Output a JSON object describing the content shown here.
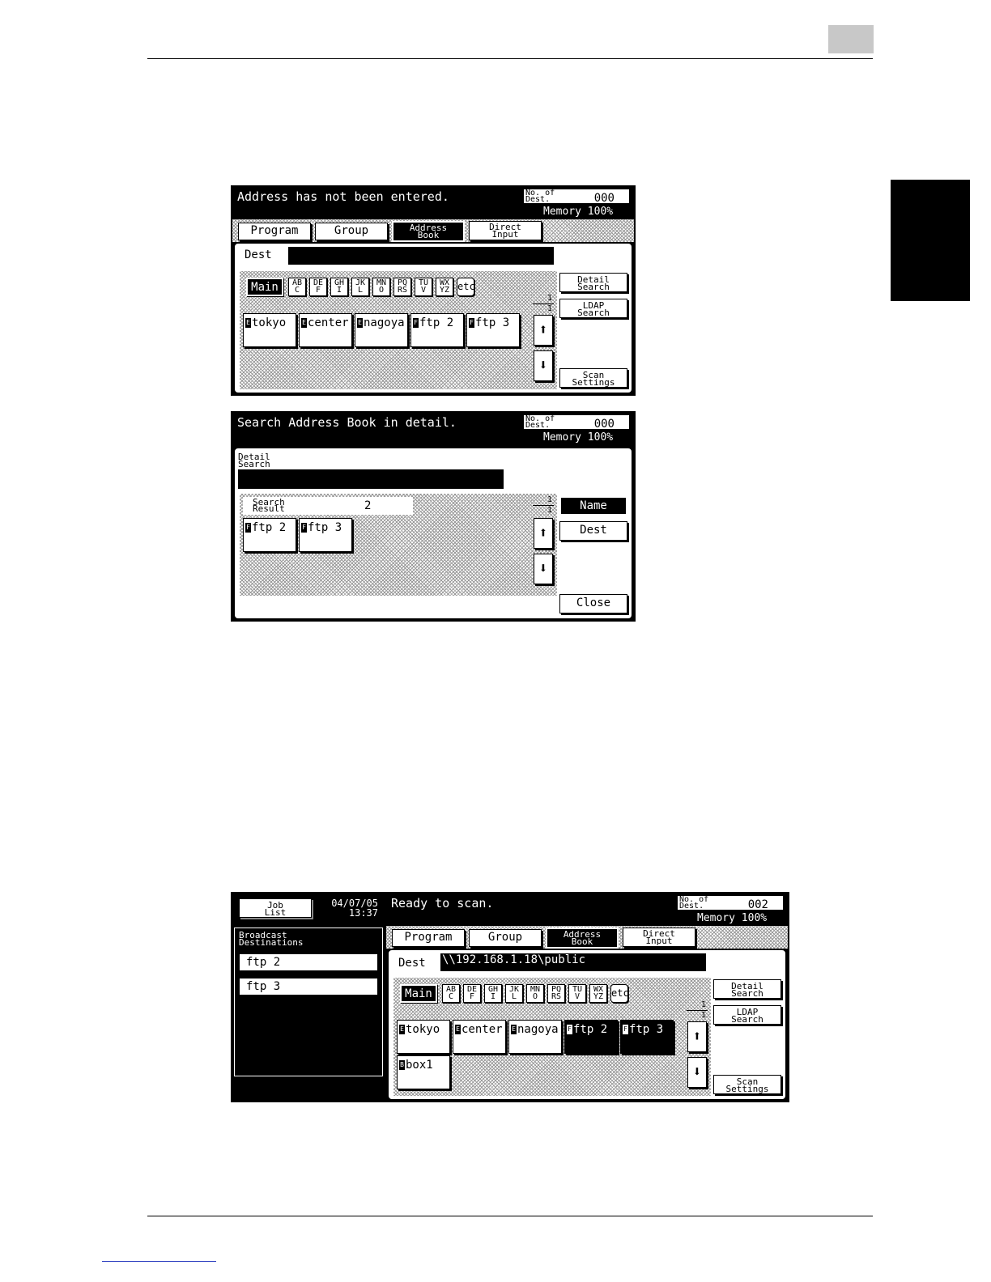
{
  "page": {
    "chapter_tab_color": "#000000",
    "link_color": "#2a3cbf"
  },
  "screen1": {
    "message": "Address has not been entered.",
    "counter_label": "No. of\nDest.",
    "counter_value": "000",
    "memory": "Memory  100%",
    "tabs": [
      "Program",
      "Group",
      "Address\nBook",
      "Direct\nInput"
    ],
    "dest_label": "Dest",
    "dest_value": "",
    "index_main": "Main",
    "index_buttons": [
      "AB\nC",
      "DE\nF",
      "GH\nI",
      "JK\nL",
      "MN\nO",
      "PQ\nRS",
      "TU\nV",
      "WX\nYZ",
      "etc"
    ],
    "keys": [
      {
        "icon": "E",
        "label": "tokyo"
      },
      {
        "icon": "E",
        "label": "center"
      },
      {
        "icon": "E",
        "label": "nagoya"
      },
      {
        "icon": "F",
        "label": "ftp 2"
      },
      {
        "icon": "F",
        "label": "ftp 3"
      }
    ],
    "page_current": "1",
    "page_total": "1",
    "right_buttons": [
      "Detail\nSearch",
      "LDAP\nSearch",
      "Scan\nSettings"
    ]
  },
  "screen2": {
    "message": "Search Address Book in detail.",
    "counter_label": "No. of\nDest.",
    "counter_value": "000",
    "memory": "Memory  100%",
    "detail_label": "Detail\nSearch",
    "search_result_label": "Search\nResult",
    "search_result_count": "2",
    "keys": [
      {
        "icon": "F",
        "label": "ftp 2"
      },
      {
        "icon": "F",
        "label": "ftp 3"
      }
    ],
    "page_current": "1",
    "page_total": "1",
    "name_button": "Name",
    "dest_button": "Dest",
    "close_button": "Close"
  },
  "screen3": {
    "job_list": "Job\nList",
    "datetime": "04/07/05\n13:37",
    "message": "Ready to scan.",
    "counter_label": "No. of\nDest.",
    "counter_value": "002",
    "memory": "Memory  100%",
    "broadcast_title": "Broadcast\nDestinations",
    "broadcast_items": [
      "ftp 2",
      "ftp 3"
    ],
    "tabs": [
      "Program",
      "Group",
      "Address\nBook",
      "Direct\nInput"
    ],
    "dest_label": "Dest",
    "dest_value": "\\\\192.168.1.18\\public",
    "index_main": "Main",
    "index_buttons": [
      "AB\nC",
      "DE\nF",
      "GH\nI",
      "JK\nL",
      "MN\nO",
      "PQ\nRS",
      "TU\nV",
      "WX\nYZ",
      "etc"
    ],
    "keys": [
      {
        "icon": "E",
        "label": "tokyo"
      },
      {
        "icon": "E",
        "label": "center"
      },
      {
        "icon": "E",
        "label": "nagoya"
      },
      {
        "icon": "F",
        "label": "ftp 2"
      },
      {
        "icon": "F",
        "label": "ftp 3"
      },
      {
        "icon": "B",
        "label": "box1"
      }
    ],
    "page_current": "1",
    "page_total": "1",
    "right_buttons": [
      "Detail\nSearch",
      "LDAP\nSearch",
      "Scan\nSettings"
    ]
  }
}
